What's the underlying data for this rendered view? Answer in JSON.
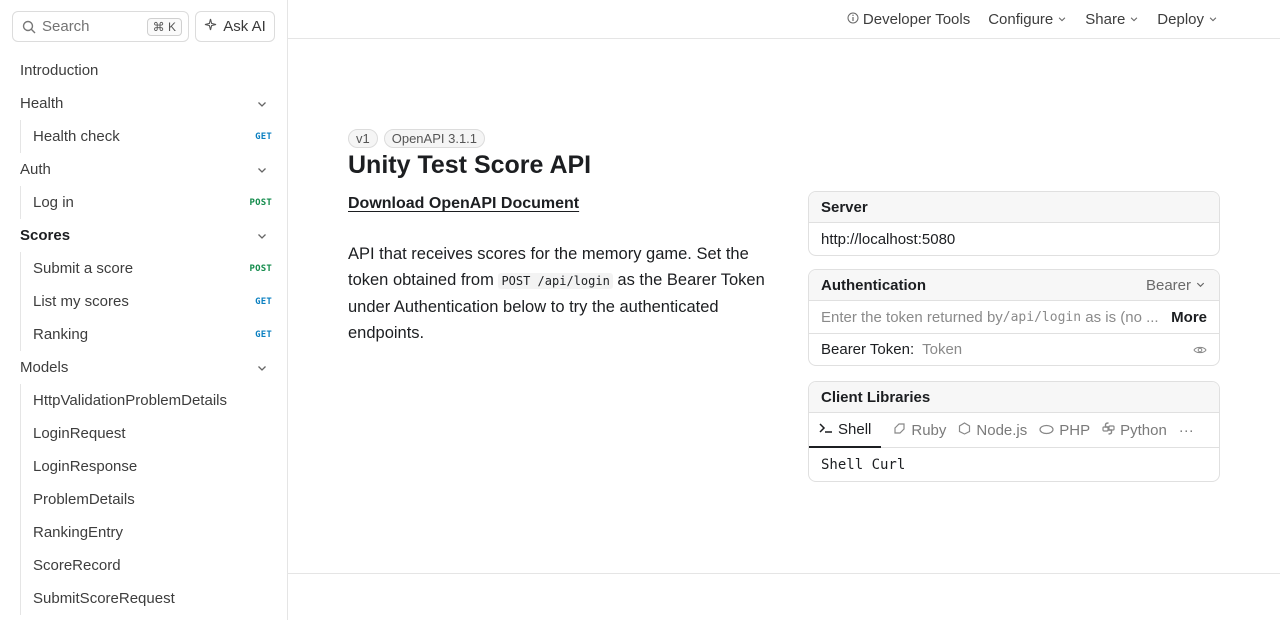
{
  "sidebar": {
    "search_placeholder": "Search",
    "search_shortcut": "⌘ K",
    "ask_ai_label": "Ask AI",
    "nav": {
      "introduction": "Introduction",
      "health": "Health",
      "health_check": "Health check",
      "auth": "Auth",
      "log_in": "Log in",
      "scores": "Scores",
      "submit_score": "Submit a score",
      "list_scores": "List my scores",
      "ranking": "Ranking",
      "models": "Models",
      "model_1": "HttpValidationProblemDetails",
      "model_2": "LoginRequest",
      "model_3": "LoginResponse",
      "model_4": "ProblemDetails",
      "model_5": "RankingEntry",
      "model_6": "ScoreRecord",
      "model_7": "SubmitScoreRequest"
    },
    "methods": {
      "get": "GET",
      "post": "POST"
    }
  },
  "topbar": {
    "developer_tools": "Developer Tools",
    "configure": "Configure",
    "share": "Share",
    "deploy": "Deploy"
  },
  "main": {
    "version_badge": "v1",
    "openapi_badge": "OpenAPI 3.1.1",
    "title": "Unity Test Score API",
    "download_link": "Download OpenAPI Document",
    "desc_part1": "API that receives scores for the memory game. Set the token obtained from ",
    "desc_code": "POST /api/login",
    "desc_part2": " as the Bearer Token under Authentication below to try the authenticated endpoints."
  },
  "server_card": {
    "title": "Server",
    "url": "http://localhost:5080"
  },
  "auth_card": {
    "title": "Authentication",
    "scheme": "Bearer",
    "hint_prefix": "Enter the token returned by ",
    "hint_code": "/api/login",
    "hint_suffix": " as is (no ...",
    "more_label": "More",
    "token_label": "Bearer Token:",
    "token_placeholder": "Token"
  },
  "client_card": {
    "title": "Client Libraries",
    "tabs": [
      "Shell",
      "Ruby",
      "Node.js",
      "PHP",
      "Python",
      "···"
    ],
    "code": "Shell Curl"
  }
}
